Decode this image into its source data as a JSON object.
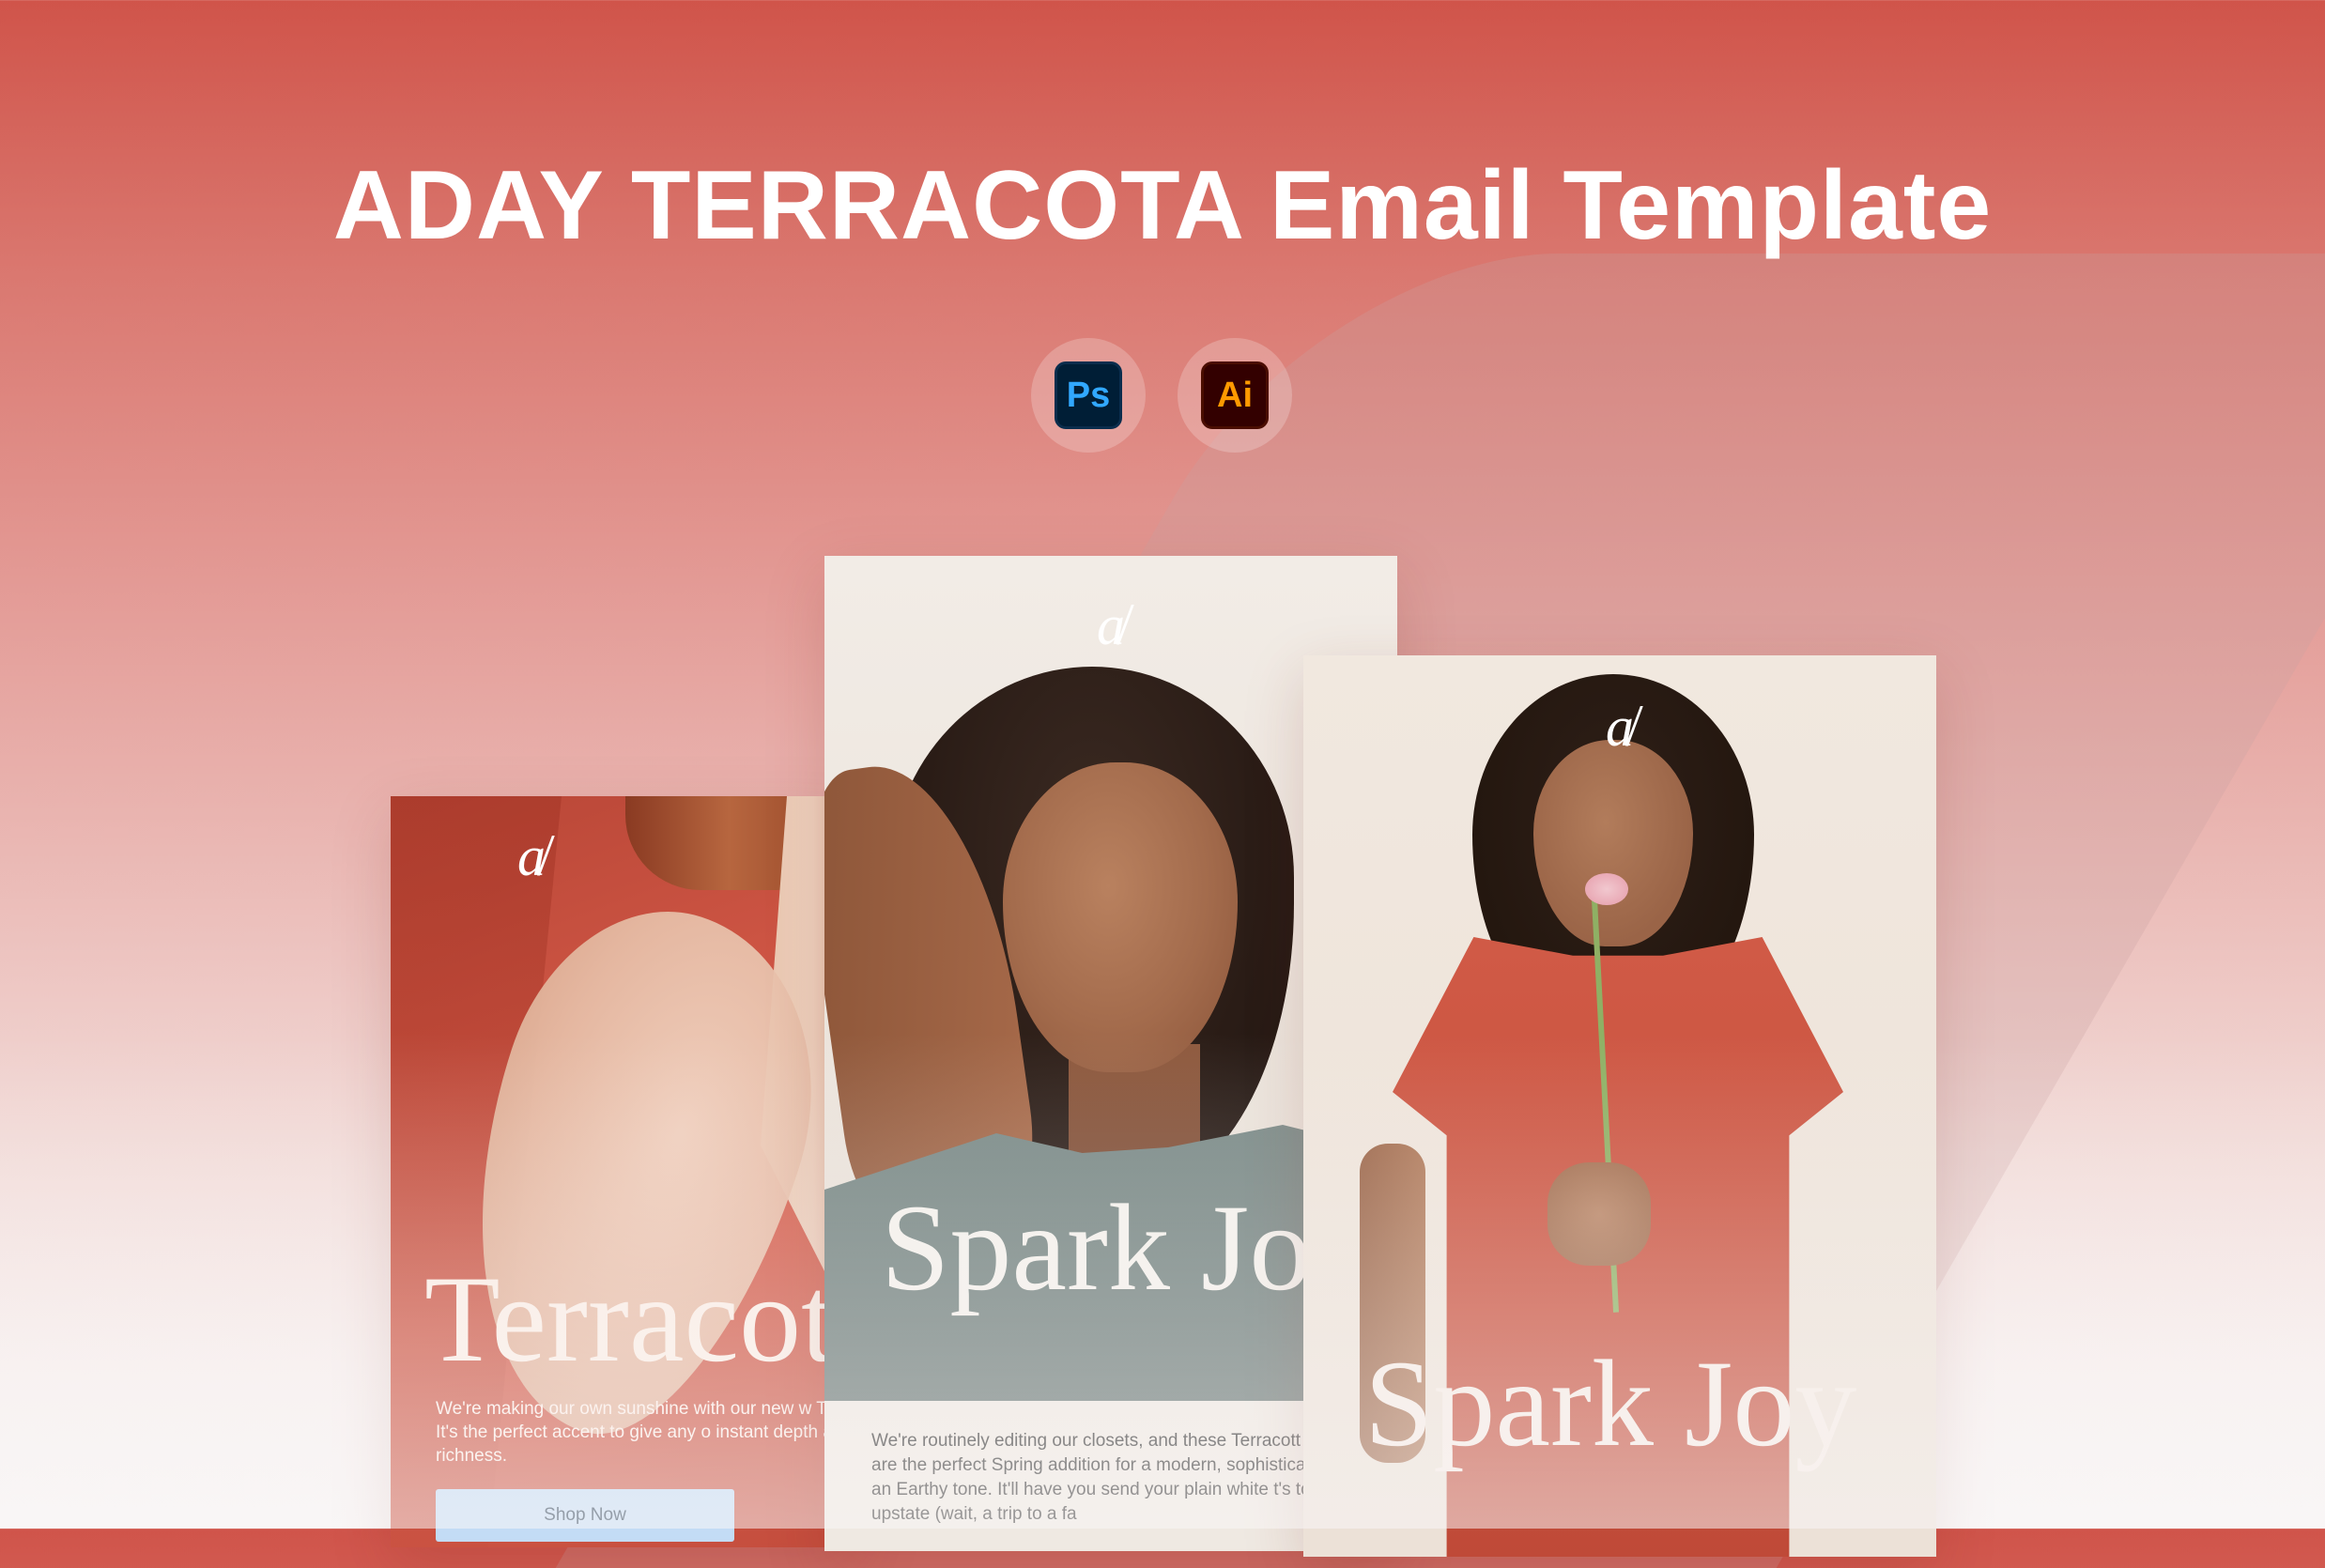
{
  "hero": {
    "title": "ADAY TERRACOTA Email Template"
  },
  "apps": [
    {
      "name": "Photoshop",
      "label": "Ps",
      "icon": "photoshop-icon",
      "bg": "#001e36",
      "fg": "#31a8ff"
    },
    {
      "name": "Illustrator",
      "label": "Ai",
      "icon": "illustrator-icon",
      "bg": "#330000",
      "fg": "#ff9a00"
    }
  ],
  "cards": {
    "left": {
      "logo": "a̴",
      "headline": "Terracot",
      "body": "We're making our own sunshine with our new w Terracotta. It's the perfect accent to give any o instant depth and richness.",
      "cta": "Shop Now",
      "cta_color": "#c3dcf5"
    },
    "middle": {
      "logo": "a̴",
      "headline": "Spark Joy",
      "body": "We're routinely editing our closets, and these Terracott T-Shirts are the perfect Spring addition for a modern, sophisticated take on an Earthy tone. It'll have you send your plain white t's to a farm upstate (wait, a trip to a fa"
    },
    "right": {
      "logo": "a̴",
      "headline": "Spark Joy"
    }
  },
  "colors": {
    "background_top": "#d0544a",
    "background_bottom": "#f9f6f6",
    "terracotta": "#c95040"
  }
}
